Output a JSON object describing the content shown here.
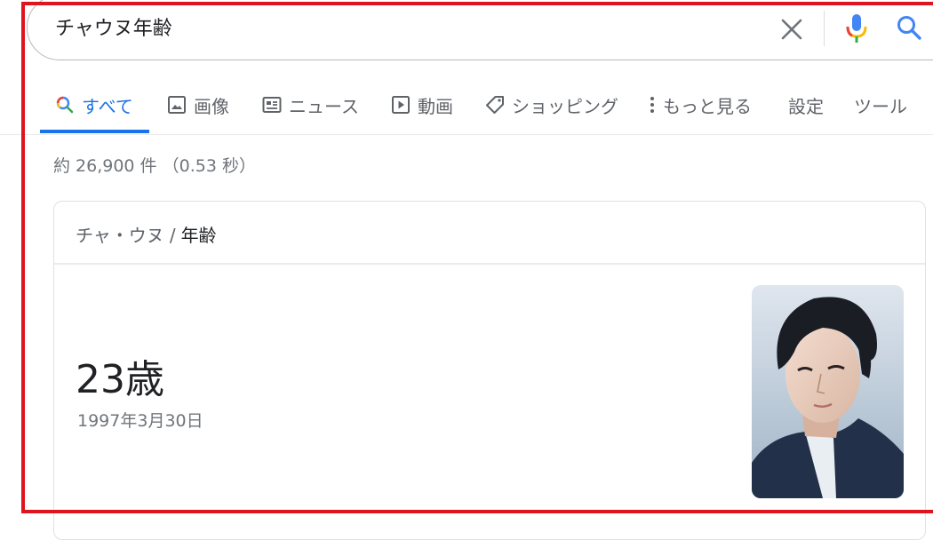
{
  "search": {
    "query": "チャウヌ年齢"
  },
  "tabs": [
    {
      "label": "すべて",
      "icon": "search-icon",
      "active": true
    },
    {
      "label": "画像",
      "icon": "image-icon"
    },
    {
      "label": "ニュース",
      "icon": "news-icon"
    },
    {
      "label": "動画",
      "icon": "video-icon"
    },
    {
      "label": "ショッピング",
      "icon": "tag-icon"
    },
    {
      "label": "もっと見る",
      "icon": "more-vert-icon"
    }
  ],
  "tools": {
    "settings": "設定",
    "tools": "ツール"
  },
  "stats": "約 26,900 件 （0.53 秒）",
  "card": {
    "breadcrumb_parent": "チャ・ウヌ",
    "breadcrumb_sep": "/",
    "breadcrumb_current": "年齢",
    "answer": "23歳",
    "answer_sub": "1997年3月30日"
  },
  "colors": {
    "accent": "#1a73e8",
    "highlight": "#e0141e"
  }
}
